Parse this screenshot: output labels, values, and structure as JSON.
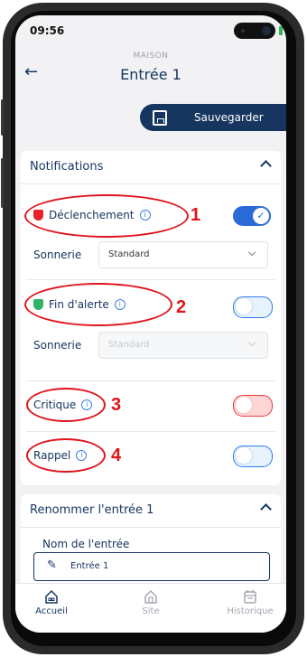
{
  "status": {
    "time": "09:56"
  },
  "header": {
    "kicker": "MAISON",
    "title": "Entrée 1"
  },
  "toolbar": {
    "save_label": "Sauvegarder"
  },
  "notifications": {
    "title": "Notifications",
    "items": [
      {
        "label": "Déclenchement",
        "number": "1",
        "sonnerie_label": "Sonnerie",
        "sonnerie_value": "Standard",
        "toggle": "on"
      },
      {
        "label": "Fin d'alerte",
        "number": "2",
        "sonnerie_label": "Sonnerie",
        "sonnerie_value": "Standard",
        "toggle": "off"
      },
      {
        "label": "Critique",
        "number": "3",
        "toggle": "off"
      },
      {
        "label": "Rappel",
        "number": "4",
        "toggle": "off"
      }
    ]
  },
  "rename": {
    "title": "Renommer l'entrée 1",
    "field_label": "Nom de l'entrée",
    "field_value": "Entrée 1"
  },
  "nav": {
    "items": [
      {
        "label": "Accueil",
        "active": true
      },
      {
        "label": "Site",
        "active": false
      },
      {
        "label": "Historique",
        "active": false
      }
    ]
  },
  "colors": {
    "primary": "#163660",
    "toggle_on": "#2a6bd8",
    "annotation": "#e0131b",
    "alarm": "#e8222b",
    "end_alert": "#2fb36b"
  }
}
